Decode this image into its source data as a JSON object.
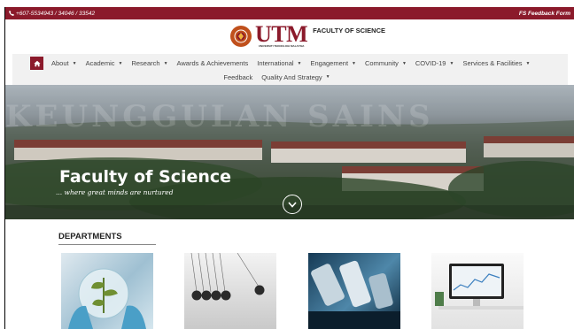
{
  "topbar": {
    "phone": "+607-5534943 / 34046 / 33542",
    "feedback_form": "FS Feedback Form"
  },
  "logo": {
    "brand": "UTM",
    "brand_sub": "UNIVERSITI TEKNOLOGI MALAYSIA",
    "faculty": "FACULTY OF SCIENCE"
  },
  "nav": {
    "row1": [
      {
        "label": "About",
        "dropdown": true
      },
      {
        "label": "Academic",
        "dropdown": true
      },
      {
        "label": "Research",
        "dropdown": true
      },
      {
        "label": "Awards & Achievements",
        "dropdown": false
      },
      {
        "label": "International",
        "dropdown": true
      },
      {
        "label": "Engagement",
        "dropdown": true
      },
      {
        "label": "Community",
        "dropdown": true
      },
      {
        "label": "COVID-19",
        "dropdown": true
      },
      {
        "label": "Services & Facilities",
        "dropdown": true
      }
    ],
    "row2": [
      {
        "label": "Feedback",
        "dropdown": false
      },
      {
        "label": "Quality And Strategy",
        "dropdown": true
      }
    ],
    "caret": "▼"
  },
  "hero": {
    "watermark": "KEUNGGULAN SAINS",
    "title": "Faculty of Science",
    "tagline": "... where great minds are nurtured"
  },
  "departments": {
    "heading": "DEPARTMENTS"
  },
  "colors": {
    "brand": "#8b1a2b",
    "emblem": "#c0501c"
  }
}
